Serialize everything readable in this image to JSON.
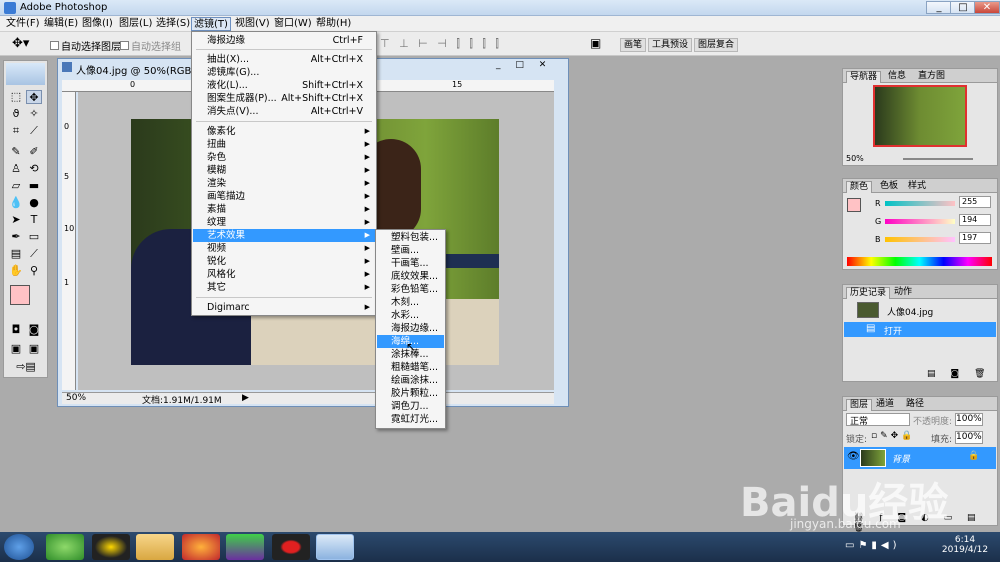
{
  "app": {
    "title": "Adobe Photoshop",
    "window_buttons": [
      "_",
      "□",
      "✕"
    ]
  },
  "menubar": [
    "文件(F)",
    "编辑(E)",
    "图像(I)",
    "图层(L)",
    "选择(S)",
    "滤镜(T)",
    "视图(V)",
    "窗口(W)",
    "帮助(H)"
  ],
  "options": {
    "auto_select_layer": "自动选择图层",
    "auto_select_group": "自动选择组",
    "tabs": [
      "画笔",
      "工具预设",
      "图层复合"
    ]
  },
  "document": {
    "title": "人像04.jpg @ 50%(RGB/8#",
    "zoom": "50%",
    "doc_size": "文档:1.91M/1.91M",
    "ruler_top": [
      "0",
      "5",
      "10",
      "15"
    ],
    "ruler_left": [
      "0",
      "5",
      "10",
      "1"
    ]
  },
  "filter_menu": {
    "items": [
      {
        "label": "海报边缘",
        "shortcut": "Ctrl+F"
      },
      {
        "label": "抽出(X)...",
        "shortcut": "Alt+Ctrl+X"
      },
      {
        "label": "滤镜库(G)...",
        "shortcut": ""
      },
      {
        "label": "液化(L)...",
        "shortcut": "Shift+Ctrl+X"
      },
      {
        "label": "图案生成器(P)...",
        "shortcut": "Alt+Shift+Ctrl+X"
      },
      {
        "label": "消失点(V)...",
        "shortcut": "Alt+Ctrl+V"
      },
      {
        "label": "像素化"
      },
      {
        "label": "扭曲"
      },
      {
        "label": "杂色"
      },
      {
        "label": "模糊"
      },
      {
        "label": "渲染"
      },
      {
        "label": "画笔描边"
      },
      {
        "label": "素描"
      },
      {
        "label": "纹理"
      },
      {
        "label": "艺术效果"
      },
      {
        "label": "视频"
      },
      {
        "label": "锐化"
      },
      {
        "label": "风格化"
      },
      {
        "label": "其它"
      },
      {
        "label": "Digimarc"
      }
    ]
  },
  "artistic_submenu": [
    "塑料包装...",
    "壁画...",
    "干画笔...",
    "底纹效果...",
    "彩色铅笔...",
    "木刻...",
    "水彩...",
    "海报边缘...",
    "海绵...",
    "涂抹棒...",
    "粗糙蜡笔...",
    "绘画涂抹...",
    "胶片颗粒...",
    "调色刀...",
    "霓虹灯光..."
  ],
  "navigator": {
    "tabs": [
      "导航器",
      "信息",
      "直方图"
    ],
    "zoom": "50%"
  },
  "color": {
    "tabs": [
      "颜色",
      "色板",
      "样式"
    ],
    "labels": [
      "R",
      "G",
      "B"
    ],
    "values": [
      "255",
      "194",
      "197"
    ]
  },
  "history": {
    "tabs": [
      "历史记录",
      "动作"
    ],
    "snapshot": "人像04.jpg",
    "step": "打开"
  },
  "layers": {
    "tabs": [
      "图层",
      "通道",
      "路径"
    ],
    "blend": "正常",
    "opacity_label": "不透明度:",
    "opacity": "100%",
    "lock_label": "锁定:",
    "fill_label": "填充:",
    "fill": "100%",
    "layer_name": "背景"
  },
  "taskbar": {
    "time": "6:14",
    "date": "2019/4/12"
  },
  "watermark": {
    "text": "Baidu经验",
    "url": "jingyan.baidu.com"
  },
  "colors": {
    "menu_highlight": "#3399ff",
    "foreground": "#ffc2c5",
    "background": "#00a000"
  }
}
